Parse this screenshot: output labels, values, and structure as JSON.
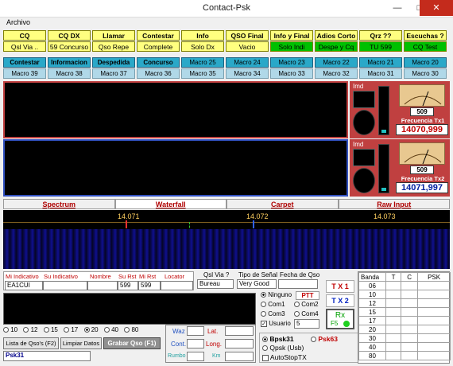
{
  "window": {
    "title": "Contact-Psk"
  },
  "menu": {
    "archivo": "Archivo"
  },
  "row1": [
    "CQ",
    "CQ DX",
    "Llamar",
    "Contestar",
    "Info",
    "QSO Final",
    "Info y Final",
    "Adios Corto",
    "Qrz ??",
    "Escuchas ?"
  ],
  "row2": [
    "Qsl Via ..",
    "59 Concurso",
    "Qso Repe",
    "Complete",
    "Solo Dx",
    "Vacio",
    "Solo Indi",
    "Despe y Cq",
    "TU 599",
    "CQ Test"
  ],
  "row3": [
    "Contestar",
    "Informacion",
    "Despedida",
    "Concurso",
    "Macro 25",
    "Macro 24",
    "Macro 23",
    "Macro 22",
    "Macro 21",
    "Macro 20"
  ],
  "row4": [
    "Macro 39",
    "Macro 38",
    "Macro 37",
    "Macro 36",
    "Macro 35",
    "Macro 34",
    "Macro 33",
    "Macro 32",
    "Macro 31",
    "Macro 30"
  ],
  "rx1": {
    "imd_label": "Imd",
    "meter_value": "509",
    "freq_label": "Frecuencia Tx1",
    "freq": "14070,999"
  },
  "rx2": {
    "imd_label": "Imd",
    "meter_value": "509",
    "freq_label": "Frecuencia Tx2",
    "freq": "14071,997"
  },
  "tabs": [
    "Spectrum",
    "Waterfall",
    "Carpet",
    "Raw Input"
  ],
  "waterfall": {
    "ticks": [
      "14.071",
      "14.072",
      "14.073"
    ]
  },
  "log": {
    "headers": [
      "Mi Indicativo",
      "Su Indicativo",
      "Nombre",
      "Su Rst",
      "Mi Rst",
      "Locator"
    ],
    "values": [
      "EA1CUI",
      "",
      "",
      "599",
      "599",
      ""
    ]
  },
  "qsl": {
    "via_label": "Qsl Via ?",
    "via_value": "Bureau",
    "signal_label": "Tipo de Señal",
    "signal_value": "Very Good",
    "date_label": "Fecha de Qso",
    "date_value": ""
  },
  "ptt": {
    "ninguno": "Ninguno",
    "ptt": "PTT",
    "com1": "Com1",
    "com2": "Com2",
    "com3": "Com3",
    "com4": "Com4",
    "usuario": "Usuario",
    "usuario_value": "5"
  },
  "tx": {
    "tx1": "T X 1",
    "tx2": "T X 2",
    "rx": "Rx",
    "f5": "F5"
  },
  "modes": {
    "bpsk31": "Bpsk31",
    "psk63": "Psk63",
    "qpsk": "Qpsk (Usb)",
    "autostop": "AutoStopTX"
  },
  "bands_label": "Banda",
  "bands": [
    "06",
    "10",
    "12",
    "15",
    "17",
    "20",
    "30",
    "40",
    "80"
  ],
  "band_cols": [
    "T",
    "C",
    "PSK"
  ],
  "band_select": {
    "options": [
      "10",
      "12",
      "15",
      "17",
      "20",
      "40",
      "80"
    ],
    "selected": "20"
  },
  "actions": {
    "lista": "Lista de Qso's (F2)",
    "limpiar": "Limpiar Datos",
    "grabar": "Grabar Qso (F1)"
  },
  "call_input": "Psk31",
  "geo": {
    "waz": "Waz",
    "lat": "Lat.",
    "cont": "Cont.",
    "long": "Long.",
    "rumbo": "Rumbo",
    "km": "Km"
  },
  "colors": {
    "yellow": "#ffff80",
    "cyan": "#2aa8c8",
    "light": "#b0d8e8",
    "green": "#00c000",
    "freq": "#c00000"
  }
}
